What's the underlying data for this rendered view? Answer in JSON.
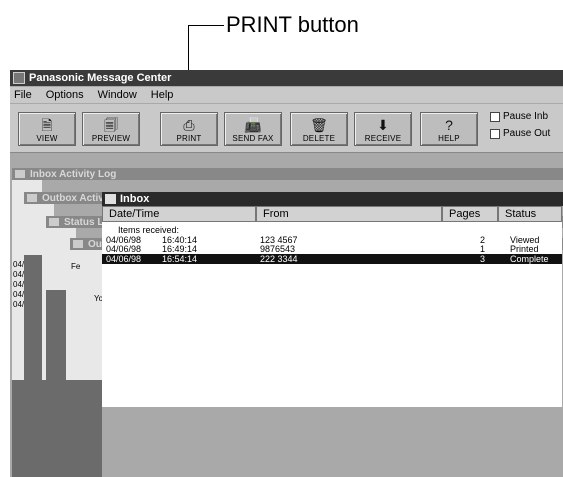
{
  "annotation": {
    "label": "PRINT button"
  },
  "app": {
    "title": "Panasonic Message Center"
  },
  "menu": [
    "File",
    "Options",
    "Window",
    "Help"
  ],
  "toolbar": {
    "buttons": [
      {
        "label": "VIEW",
        "icon": "document-icon"
      },
      {
        "label": "PREVIEW",
        "icon": "preview-icon"
      },
      {
        "label": "PRINT",
        "icon": "printer-icon"
      },
      {
        "label": "SEND FAX",
        "icon": "send-fax-icon"
      },
      {
        "label": "DELETE",
        "icon": "delete-icon"
      },
      {
        "label": "RECEIVE",
        "icon": "receive-icon"
      },
      {
        "label": "HELP",
        "icon": "help-icon"
      }
    ],
    "checkboxes": [
      "Pause Inb",
      "Pause Out"
    ]
  },
  "windows": {
    "inbox_activity": "Inbox Activity Log",
    "outbox_activity": "Outbox Activity Log",
    "status_log": "Status Log",
    "outbox": "Outbox",
    "inbox": "Inbox"
  },
  "inbox": {
    "columns": [
      "Date/Time",
      "From",
      "Pages",
      "Status"
    ],
    "items_received": "Items received:",
    "rows": [
      {
        "date": "04/06/98",
        "time": "16:40:14",
        "from": "123 4567",
        "pages": "2",
        "status": "Viewed"
      },
      {
        "date": "04/06/98",
        "time": "16:49:14",
        "from": "9876543",
        "pages": "1",
        "status": "Printed"
      },
      {
        "date": "04/06/98",
        "time": "16:54:14",
        "from": "222 3344",
        "pages": "3",
        "status": "Complete"
      }
    ]
  },
  "behind_text": {
    "date_stubs": [
      "04/",
      "04/",
      "04/",
      "04/",
      "04/"
    ],
    "fe": "Fe",
    "yo": "Yo"
  }
}
